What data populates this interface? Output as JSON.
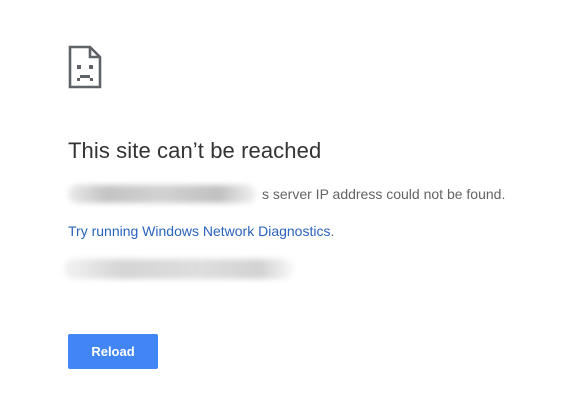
{
  "error": {
    "icon": "sad-page-icon",
    "title": "This site can’t be reached",
    "message": "s server IP address could not be found.",
    "diagnostics_link": "Try running Windows Network Diagnostics",
    "diagnostics_suffix": ".",
    "reload_label": "Reload"
  },
  "colors": {
    "title": "#333333",
    "body_text": "#646464",
    "link": "#2a63bd",
    "button": "#4285f4",
    "button_text": "#ffffff"
  }
}
